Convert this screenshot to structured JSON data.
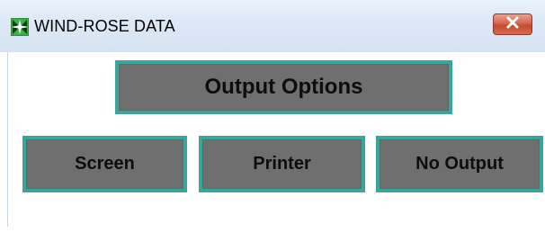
{
  "window": {
    "title": "WIND-ROSE DATA",
    "app_icon": "wind-rose-app-icon",
    "close_icon": "close-icon",
    "close_glyph": "✕"
  },
  "output_options": {
    "header_label": "Output Options",
    "buttons": [
      {
        "label": "Screen"
      },
      {
        "label": "Printer"
      },
      {
        "label": "No Output"
      }
    ]
  },
  "colors": {
    "button_fill": "#6f6f6f",
    "button_border": "#3aa59a",
    "titlebar": "#dde8f6",
    "close_button": "#d6664d"
  }
}
